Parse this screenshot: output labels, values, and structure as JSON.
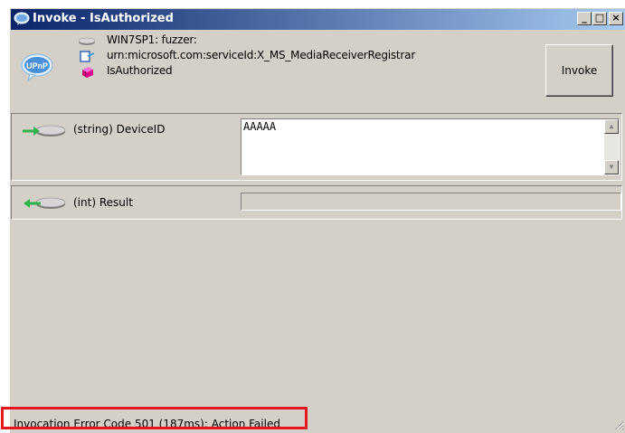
{
  "window": {
    "title": "Invoke - IsAuthorized",
    "controls": {
      "minimize": "_",
      "maximize": "□",
      "close": "×"
    }
  },
  "header": {
    "device": "WIN7SP1: fuzzer:",
    "service": "urn:microsoft.com:serviceId:X_MS_MediaReceiverRegistrar",
    "action": "IsAuthorized",
    "invoke_label": "Invoke"
  },
  "arguments": [
    {
      "label": "(string) DeviceID",
      "direction": "in",
      "value": "AAAAA"
    },
    {
      "label": "(int) Result",
      "direction": "out",
      "value": ""
    }
  ],
  "status": {
    "text": "Invocation Error Code 501 (187ms): Action Failed"
  },
  "colors": {
    "titlebar_start": "#0a246a",
    "titlebar_end": "#a6caf0",
    "highlight": "#e8141e",
    "window_bg": "#d4d0c8"
  },
  "icons": {
    "app": "upnp-globe-icon",
    "device": "device-icon",
    "service": "service-icon",
    "action": "action-icon",
    "in_arg": "input-arrow-icon",
    "out_arg": "output-arrow-icon"
  }
}
